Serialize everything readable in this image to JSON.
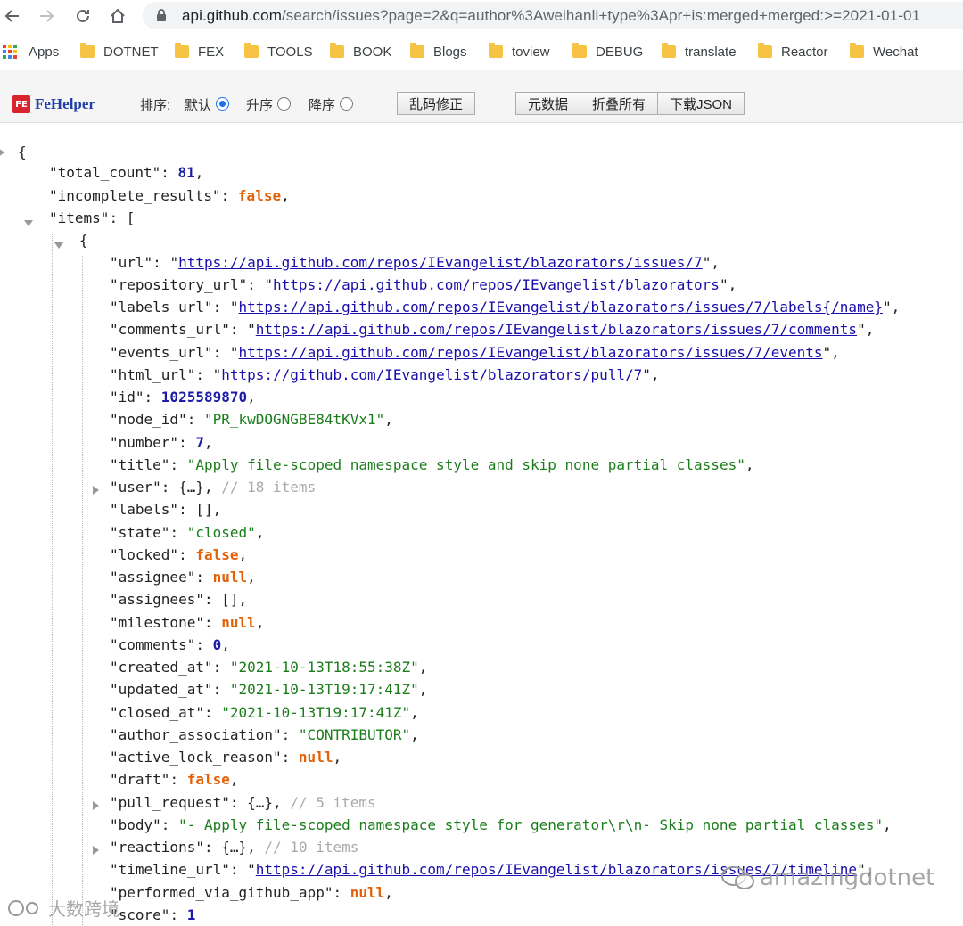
{
  "address_bar": {
    "host": "api.github.com",
    "path": "/search/issues?page=2&q=author%3Aweihanli+type%3Apr+is:merged+merged:>=2021-01-01"
  },
  "bookmarks": [
    {
      "label": "Apps",
      "icon": "apps-grid-icon"
    },
    {
      "label": "DOTNET",
      "icon": "folder-icon"
    },
    {
      "label": "FEX",
      "icon": "folder-icon"
    },
    {
      "label": "TOOLS",
      "icon": "folder-icon"
    },
    {
      "label": "BOOK",
      "icon": "folder-icon"
    },
    {
      "label": "Blogs",
      "icon": "folder-icon"
    },
    {
      "label": "toview",
      "icon": "folder-icon"
    },
    {
      "label": "DEBUG",
      "icon": "folder-icon"
    },
    {
      "label": "translate",
      "icon": "folder-icon"
    },
    {
      "label": "Reactor",
      "icon": "folder-icon"
    },
    {
      "label": "Wechat",
      "icon": "folder-icon"
    }
  ],
  "fehelper": {
    "badge": "FE",
    "name": "FeHelper",
    "sort_label": "排序:",
    "sort_default": "默认",
    "sort_asc": "升序",
    "sort_desc": "降序",
    "fix_encoding": "乱码修正",
    "metadata": "元数据",
    "collapse_all": "折叠所有",
    "download_json": "下载JSON"
  },
  "json": {
    "total_count": "81",
    "incomplete_results": "false",
    "item": {
      "url": "https://api.github.com/repos/IEvangelist/blazorators/issues/7",
      "repository_url": "https://api.github.com/repos/IEvangelist/blazorators",
      "labels_url": "https://api.github.com/repos/IEvangelist/blazorators/issues/7/labels{/name}",
      "comments_url": "https://api.github.com/repos/IEvangelist/blazorators/issues/7/comments",
      "events_url": "https://api.github.com/repos/IEvangelist/blazorators/issues/7/events",
      "html_url": "https://github.com/IEvangelist/blazorators/pull/7",
      "id": "1025589870",
      "node_id": "\"PR_kwDOGNGBE84tKVx1\"",
      "number": "7",
      "title": "\"Apply file-scoped namespace style and skip none partial classes\"",
      "user_comment": "// 18 items",
      "state": "\"closed\"",
      "locked": "false",
      "assignee": "null",
      "milestone": "null",
      "comments": "0",
      "created_at": "\"2021-10-13T18:55:38Z\"",
      "updated_at": "\"2021-10-13T19:17:41Z\"",
      "closed_at": "\"2021-10-13T19:17:41Z\"",
      "author_association": "\"CONTRIBUTOR\"",
      "active_lock_reason": "null",
      "draft": "false",
      "pull_request_comment": "// 5 items",
      "body": "\"- Apply file-scoped namespace style for generator\\r\\n- Skip none partial classes\"",
      "reactions_comment": "// 10 items",
      "timeline_url": "https://api.github.com/repos/IEvangelist/blazorators/issues/7/timeline",
      "performed_via_github_app": "null",
      "score": "1"
    }
  },
  "watermarks": {
    "left": "大数跨境",
    "right": "amazingdotnet"
  },
  "colors": {
    "string": "#1a7d1a",
    "number": "#1c1ca8",
    "keyword": "#e36209",
    "link": "#1a0dab",
    "fe_brand": "#d9232e"
  }
}
